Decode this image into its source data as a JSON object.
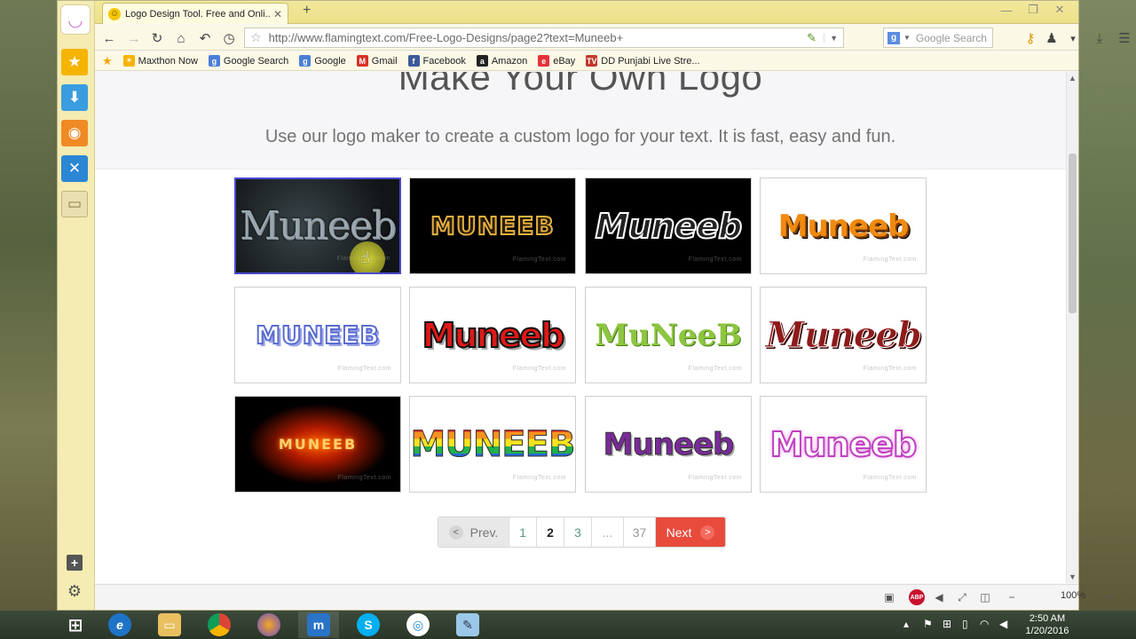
{
  "tab": {
    "title": "Logo Design Tool. Free and Onli...",
    "close": "✕"
  },
  "new_tab": "+",
  "window_controls": {
    "minimize": "—",
    "restore": "❐",
    "close": "✕"
  },
  "address": {
    "url": "http://www.flamingtext.com/Free-Logo-Designs/page2?text=Muneeb+"
  },
  "search": {
    "placeholder": "Google Search"
  },
  "bookmarks": [
    {
      "label": "Maxthon Now",
      "icon": "sun-icon",
      "color": "#f5b400",
      "glyph": "☀"
    },
    {
      "label": "Google Search",
      "icon": "google-icon",
      "color": "#4a7fd8",
      "glyph": "g"
    },
    {
      "label": "Google",
      "icon": "google-icon",
      "color": "#4a7fd8",
      "glyph": "g"
    },
    {
      "label": "Gmail",
      "icon": "gmail-icon",
      "color": "#d93025",
      "glyph": "M"
    },
    {
      "label": "Facebook",
      "icon": "facebook-icon",
      "color": "#3b5998",
      "glyph": "f"
    },
    {
      "label": "Amazon",
      "icon": "amazon-icon",
      "color": "#222222",
      "glyph": "a"
    },
    {
      "label": "eBay",
      "icon": "ebay-icon",
      "color": "#e53238",
      "glyph": "e"
    },
    {
      "label": "DD Punjabi Live Stre...",
      "icon": "tv-icon",
      "color": "#c0392b",
      "glyph": "TV"
    }
  ],
  "hero": {
    "title": "Make Your Own Logo",
    "subtitle": "Use our logo maker to create a custom logo for your text. It is fast, easy and fun."
  },
  "logos": [
    {
      "text": "Muneeb",
      "style": "dark-gothic",
      "bg": "#1b2124",
      "fg": "#9aa7b0"
    },
    {
      "text": "MUNEEB",
      "style": "gold-outline",
      "bg": "#000000",
      "fg": "#e6b040"
    },
    {
      "text": "Muneeb",
      "style": "white-sketch",
      "bg": "#000000",
      "fg": "#ffffff"
    },
    {
      "text": "Muneeb",
      "style": "orange-3d",
      "bg": "#ffffff",
      "fg": "#f08a10"
    },
    {
      "text": "MUNEEB",
      "style": "blue-outline",
      "bg": "#ffffff",
      "fg": "#ffffff"
    },
    {
      "text": "Muneeb",
      "style": "red-bubble",
      "bg": "#ffffff",
      "fg": "#e01818"
    },
    {
      "text": "MuNeeB",
      "style": "green-leaf",
      "bg": "#ffffff",
      "fg": "#8cc63f"
    },
    {
      "text": "Muneeb",
      "style": "dark-red-script",
      "bg": "#ffffff",
      "fg": "#8e1a1a"
    },
    {
      "text": "MUNEEB",
      "style": "fire-glow",
      "bg": "#000000",
      "fg": "#ffd070"
    },
    {
      "text": "MUNEEB",
      "style": "rainbow",
      "bg": "#ffffff",
      "fg": "#e02020"
    },
    {
      "text": "Muneeb",
      "style": "purple-bold",
      "bg": "#ffffff",
      "fg": "#7a2a9a"
    },
    {
      "text": "Muneeb",
      "style": "pink-glow",
      "bg": "#ffffff",
      "fg": "#ffffff"
    }
  ],
  "watermark": "FlamingText.com",
  "pagination": {
    "prev": "Prev.",
    "pages": [
      "1",
      "2",
      "3",
      "...",
      "37"
    ],
    "current": "2",
    "next": "Next"
  },
  "status": {
    "zoom": "100%"
  },
  "clock": {
    "time": "2:50 AM",
    "date": "1/20/2016"
  },
  "colors": {
    "next_button": "#e84b3c",
    "selected_border": "#4a4ad0",
    "sidebar": "#f4ecb2"
  }
}
